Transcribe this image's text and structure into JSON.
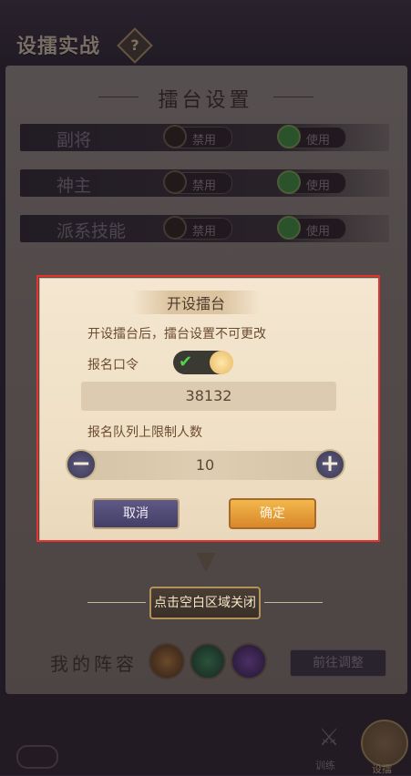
{
  "header": {
    "title": "设擂实战",
    "help_glyph": "?"
  },
  "panel": {
    "title": "擂台设置",
    "rows": [
      {
        "label": "副将",
        "off_label": "禁用",
        "on_label": "使用"
      },
      {
        "label": "神主",
        "off_label": "禁用",
        "on_label": "使用"
      },
      {
        "label": "派系技能",
        "off_label": "禁用",
        "on_label": "使用"
      }
    ]
  },
  "dialog": {
    "title": "开设擂台",
    "notice": "开设擂台后，擂台设置不可更改",
    "password_label": "报名口令",
    "password_enabled": true,
    "password_value": "38132",
    "limit_label": "报名队列上限制人数",
    "limit_value": "10",
    "minus_glyph": "−",
    "plus_glyph": "+",
    "cancel_label": "取消",
    "confirm_label": "确定"
  },
  "close_hint": "点击空白区域关闭",
  "lineup": {
    "label": "我的阵容",
    "goto_label": "前往调整"
  },
  "bottom_nav": {
    "train_label": "训练",
    "setup_label": "设擂"
  },
  "colors": {
    "accent_gold": "#e6b864",
    "toggle_on": "#4fd44f",
    "highlight_frame": "#e53333"
  }
}
